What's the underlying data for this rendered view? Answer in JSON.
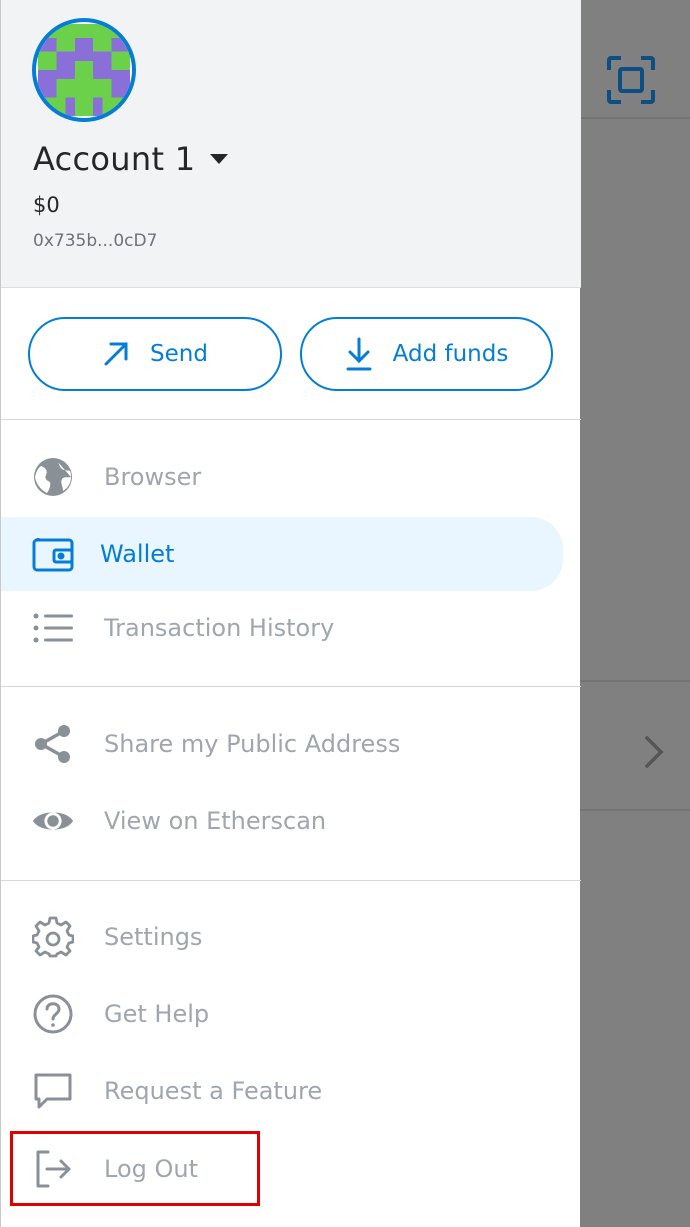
{
  "account": {
    "name": "Account 1",
    "balance": "$0",
    "address": "0x735b...0cD7"
  },
  "actions": {
    "send_label": "Send",
    "add_funds_label": "Add funds"
  },
  "menu": {
    "browser": "Browser",
    "wallet": "Wallet",
    "transaction_history": "Transaction History",
    "share_address": "Share my Public Address",
    "view_etherscan": "View on Etherscan",
    "settings": "Settings",
    "get_help": "Get Help",
    "request_feature": "Request a Feature",
    "log_out": "Log Out"
  },
  "colors": {
    "accent": "#037dd6",
    "muted_text": "#9fa6ae",
    "active_bg": "#eaf6ff",
    "highlight": "#e00000"
  },
  "icons": [
    "caret-down-icon",
    "send-arrow-icon",
    "download-icon",
    "globe-icon",
    "wallet-icon",
    "list-icon",
    "share-icon",
    "eye-icon",
    "gear-icon",
    "help-icon",
    "chat-bubble-icon",
    "logout-icon",
    "scan-icon",
    "chevron-right-icon"
  ]
}
